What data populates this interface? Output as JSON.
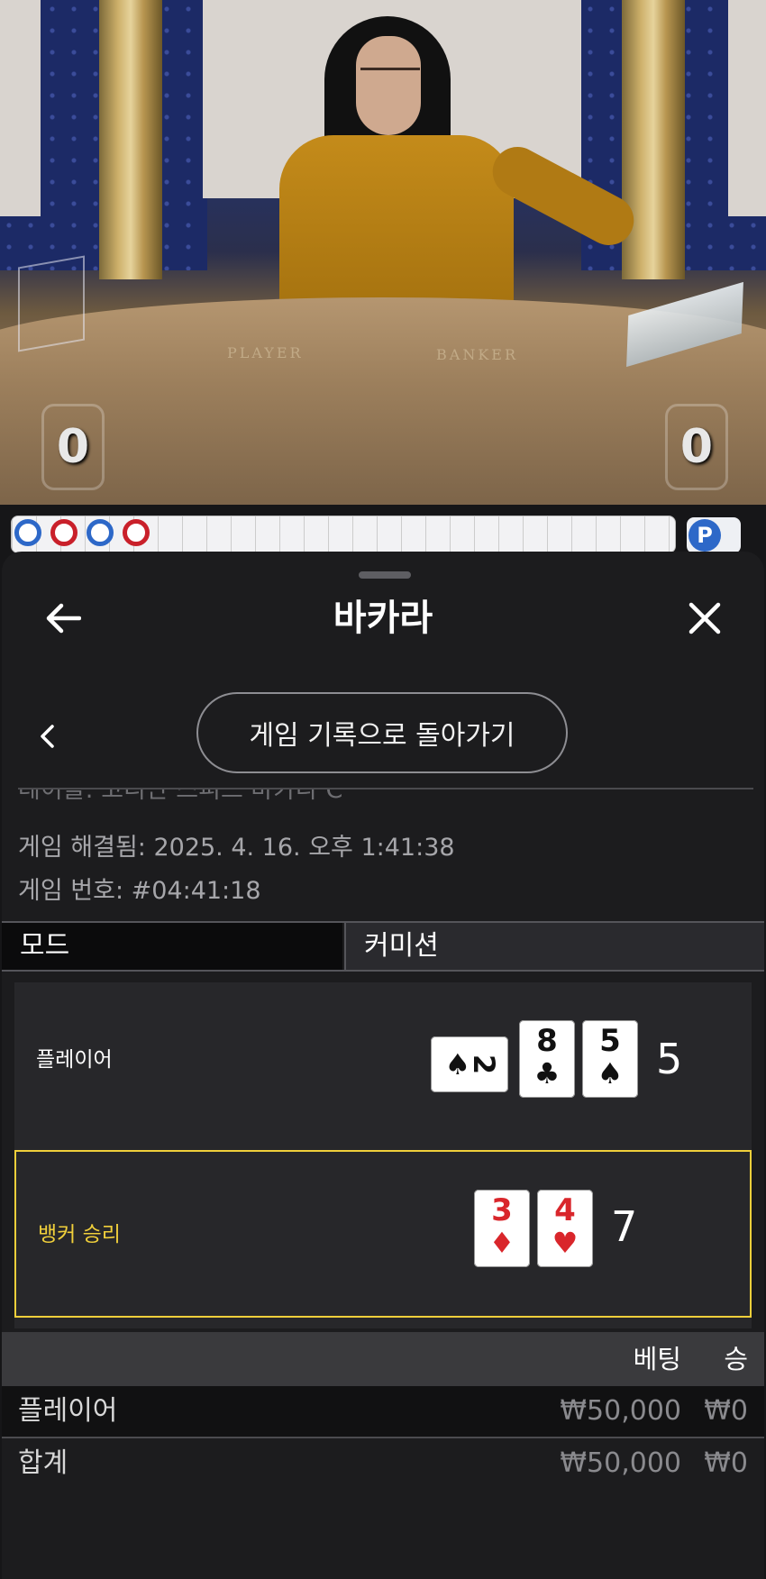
{
  "video": {
    "table_labels": {
      "player": "PLAYER",
      "banker": "BANKER"
    },
    "player_score": "0",
    "banker_score": "0",
    "road_p_badge": "P",
    "colors": {
      "player_blue": "#2d68c8",
      "banker_red": "#c9202a"
    }
  },
  "sheet": {
    "title": "바카라",
    "back_icon": "arrow-left-icon",
    "close_icon": "close-icon",
    "sub_back_icon": "chevron-left-icon",
    "back_to_history_label": "게임 기록으로 돌아가기",
    "info": {
      "table_line_partial": "테이블: 코리안 스피드 바카라 C",
      "resolved_line": "게임 해결됨: 2025. 4. 16. 오후 1:41:38",
      "game_number_line": "게임 번호: #04:41:18"
    },
    "tabs": [
      {
        "label": "모드",
        "active": true
      },
      {
        "label": "커미션",
        "active": false
      }
    ],
    "hands": {
      "player": {
        "label": "플레이어",
        "cards": [
          {
            "rank": "2",
            "suit": "♠",
            "rotated": true
          },
          {
            "rank": "8",
            "suit": "♣",
            "rotated": false
          },
          {
            "rank": "5",
            "suit": "♠",
            "rotated": false
          }
        ],
        "score": "5"
      },
      "banker": {
        "label": "뱅커 승리",
        "cards": [
          {
            "rank": "3",
            "suit": "♦",
            "rotated": false
          },
          {
            "rank": "4",
            "suit": "♥",
            "rotated": false
          }
        ],
        "score": "7",
        "winner": true,
        "highlight_color": "#f0cf3b"
      }
    },
    "bets": {
      "headers": {
        "bet": "베팅",
        "win": "승"
      },
      "rows": [
        {
          "label": "플레이어",
          "bet": "₩50,000",
          "win": "₩0"
        },
        {
          "label": "합계",
          "bet": "₩50,000",
          "win": "₩0"
        }
      ]
    }
  }
}
